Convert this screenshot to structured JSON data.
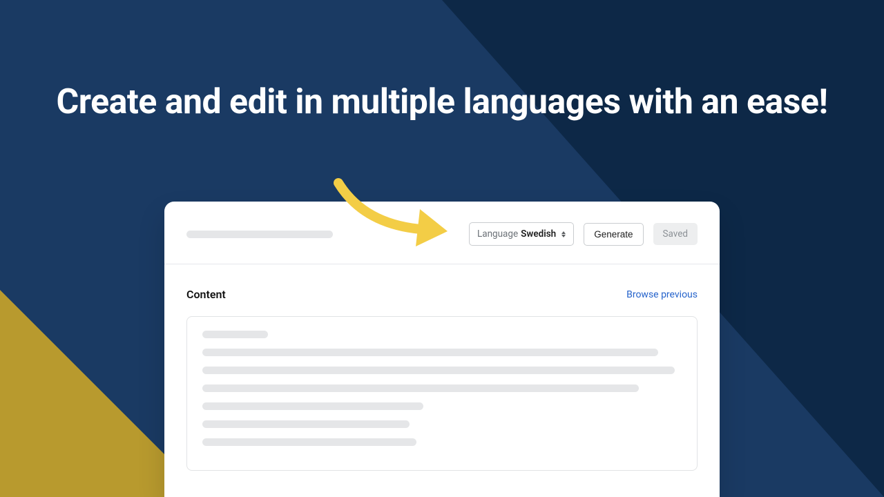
{
  "headline": "Create and edit in multiple languages with an ease!",
  "toolbar": {
    "language_label": "Language",
    "language_value": "Swedish",
    "generate_label": "Generate",
    "saved_label": "Saved"
  },
  "content": {
    "title": "Content",
    "browse_link": "Browse previous"
  }
}
